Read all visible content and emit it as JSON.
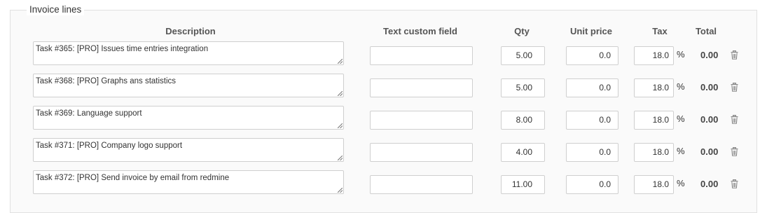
{
  "section": {
    "legend": "Invoice lines"
  },
  "headers": {
    "description": "Description",
    "custom": "Text custom field",
    "qty": "Qty",
    "unit_price": "Unit price",
    "tax": "Tax",
    "total": "Total"
  },
  "lines": [
    {
      "description": "Task #365: [PRO] Issues time entries integration",
      "custom": "",
      "qty": "5.00",
      "unit_price": "0.0",
      "tax": "18.0",
      "tax_unit": "%",
      "total": "0.00"
    },
    {
      "description": "Task #368: [PRO] Graphs ans statistics",
      "custom": "",
      "qty": "5.00",
      "unit_price": "0.0",
      "tax": "18.0",
      "tax_unit": "%",
      "total": "0.00"
    },
    {
      "description": "Task #369: Language support",
      "custom": "",
      "qty": "8.00",
      "unit_price": "0.0",
      "tax": "18.0",
      "tax_unit": "%",
      "total": "0.00"
    },
    {
      "description": "Task #371: [PRO] Company logo support",
      "custom": "",
      "qty": "4.00",
      "unit_price": "0.0",
      "tax": "18.0",
      "tax_unit": "%",
      "total": "0.00"
    },
    {
      "description": "Task #372: [PRO] Send invoice by email from redmine",
      "custom": "",
      "qty": "11.00",
      "unit_price": "0.0",
      "tax": "18.0",
      "tax_unit": "%",
      "total": "0.00"
    }
  ],
  "icons": {
    "delete": "trash-icon"
  }
}
